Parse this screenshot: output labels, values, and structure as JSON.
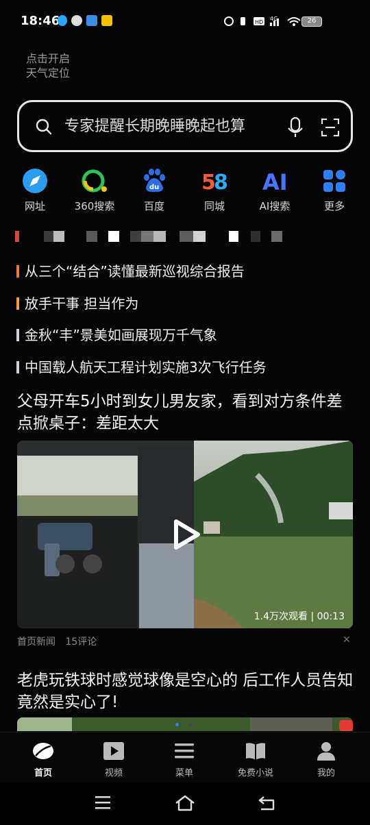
{
  "status_bar": {
    "time": "18:46",
    "network": "4G",
    "battery": "26"
  },
  "weather": {
    "line1": "点击开启",
    "line2": "天气定位"
  },
  "search": {
    "placeholder": "专家提醒长期晚睡晚起也算"
  },
  "quick_apps": [
    {
      "label": "网址",
      "icon": "compass-icon"
    },
    {
      "label": "360搜索",
      "icon": "360-search-icon"
    },
    {
      "label": "百度",
      "icon": "baidu-paw-icon"
    },
    {
      "label": "同城",
      "icon": "58-tongcheng-icon"
    },
    {
      "label": "AI搜索",
      "icon": "ai-search-icon"
    },
    {
      "label": "更多",
      "icon": "more-grid-icon"
    }
  ],
  "hot_list": [
    {
      "text": "从三个“结合”读懂最新巡视综合报告",
      "color": "#f07a3a"
    },
    {
      "text": "放手干事 担当作为",
      "color": "#f0a040"
    },
    {
      "text": "金秋“丰”景美如画展现万千气象",
      "color": "#d0d0d8"
    },
    {
      "text": "中国载人航天工程计划实施3次飞行任务",
      "color": "#d0d0d8"
    }
  ],
  "article1": {
    "title": "父母开车5小时到女儿男友家，看到对方条件差点掀桌子：差距太大",
    "video_info": "1.4万次观看 | 00:13",
    "source": "首页新闻",
    "comments": "15评论"
  },
  "article2": {
    "title": "老虎玩铁球时感觉球像是空心的 后工作人员告知竟然是实心了!"
  },
  "bottom_nav": [
    {
      "label": "首页",
      "icon": "home-leaf-icon"
    },
    {
      "label": "视频",
      "icon": "video-play-icon"
    },
    {
      "label": "菜单",
      "icon": "menu-icon"
    },
    {
      "label": "免费小说",
      "icon": "book-icon"
    },
    {
      "label": "我的",
      "icon": "person-icon"
    }
  ]
}
